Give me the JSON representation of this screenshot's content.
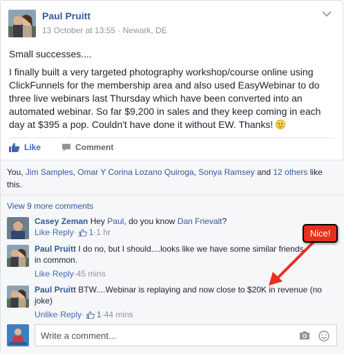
{
  "post": {
    "author": "Paul Pruitt",
    "timestamp": "13 October at 13:55",
    "separator": " · ",
    "location": "Newark, DE",
    "paragraph1": "Small successes....",
    "paragraph2": "I finally built a very targeted photography workshop/course online using ClickFunnels for the membership area and also used EasyWebinar to do three live webinars last Thursday which have been converted into an automated webinar. So far $9,200 in sales and they keep coming in each day at $395 a pop. Couldn't have done it without EW. Thanks!"
  },
  "actions": {
    "like_label": "Like",
    "comment_label": "Comment"
  },
  "likes": {
    "prefix": "You, ",
    "names": [
      "Jim Samples",
      "Omar Y Corina Lozano Quiroga",
      "Sonya Ramsey"
    ],
    "connector": " and ",
    "others": "12 others",
    "suffix": " like this."
  },
  "comments": {
    "view_more": "View 9 more comments",
    "items": [
      {
        "name": "Casey Zeman",
        "text_before": " Hey ",
        "mention1": "Paul",
        "text_middle": ", do you know ",
        "mention2": "Dan Frievalt",
        "text_after": "?",
        "like": "Like",
        "reply": "Reply",
        "likes_count": "1",
        "time": "1 hr"
      },
      {
        "name": "Paul Pruitt",
        "text": " I do no, but I should....looks like we have some similar friends in common.",
        "like": "Like",
        "reply": "Reply",
        "time": "45 mins"
      },
      {
        "name": "Paul Pruitt",
        "text": " BTW....Webinar is replaying and now close to $20K in revenue (no joke)",
        "like": "Unlike",
        "reply": "Reply",
        "likes_count": "1",
        "time": "44 mins"
      }
    ],
    "dot": " · "
  },
  "composer": {
    "placeholder": "Write a comment..."
  },
  "annotation": {
    "label": "Nice!",
    "color": "#e8301c"
  },
  "icons": [
    "chevron-down-icon",
    "like-thumb-icon",
    "comment-bubble-icon",
    "camera-icon",
    "emoji-icon",
    "smiley-emoji-icon",
    "annotation-arrow"
  ],
  "colors": {
    "link": "#365899",
    "like_blue": "#4267b2",
    "meta_gray": "#90949c",
    "panel_bg": "#f6f7f9"
  }
}
